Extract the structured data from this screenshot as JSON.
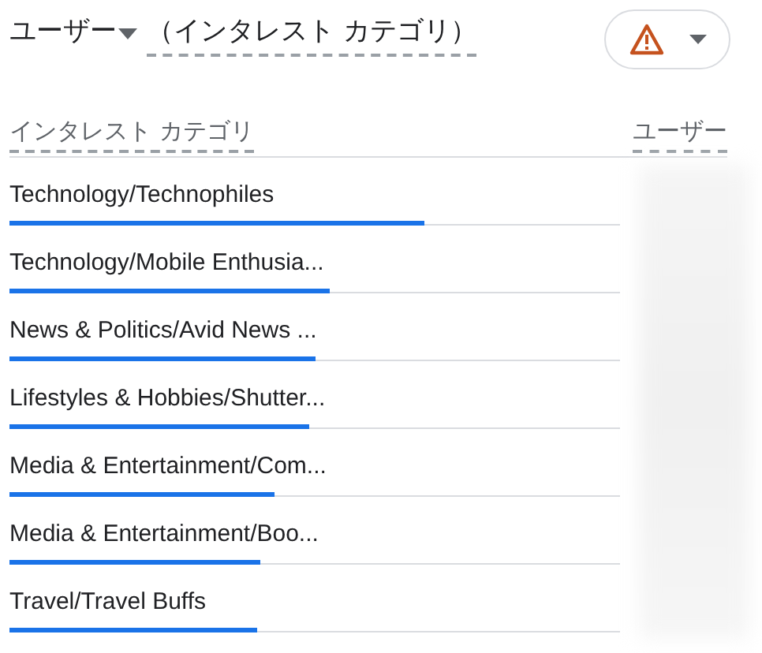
{
  "title": {
    "metric": "ユーザー",
    "dimension": "（インタレスト カテゴリ）"
  },
  "table": {
    "columns": [
      "インタレスト カテゴリ",
      "ユーザー"
    ],
    "rows": [
      {
        "label": "Technology/Technophiles",
        "level": 0.68
      },
      {
        "label": "Technology/Mobile Enthusia...",
        "level": 0.525
      },
      {
        "label": "News & Politics/Avid News ...",
        "level": 0.5
      },
      {
        "label": "Lifestyles & Hobbies/Shutter...",
        "level": 0.49
      },
      {
        "label": "Media & Entertainment/Com...",
        "level": 0.435
      },
      {
        "label": "Media & Entertainment/Boo...",
        "level": 0.41
      },
      {
        "label": "Travel/Travel Buffs",
        "level": 0.405
      }
    ]
  }
}
